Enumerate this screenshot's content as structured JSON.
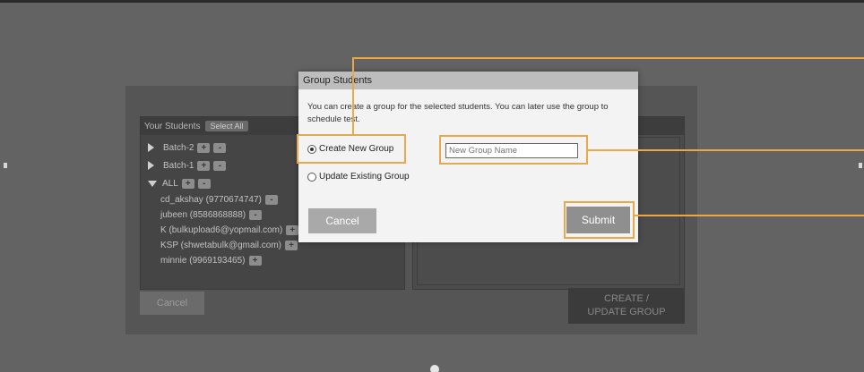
{
  "background": {
    "students_header": "Your Students",
    "select_all_label": "Select All",
    "tree": [
      {
        "label": "Batch-2",
        "expanded": false
      },
      {
        "label": "Batch-1",
        "expanded": false
      },
      {
        "label": "ALL",
        "expanded": true
      }
    ],
    "students": [
      {
        "label": "cd_akshay (9770674747)",
        "action": "-"
      },
      {
        "label": "jubeen (8586868888)",
        "action": "-"
      },
      {
        "label": "K (bulkupload6@yopmail.com)",
        "action": "+"
      },
      {
        "label": "KSP (shwetabulk@gmail.com)",
        "action": "+"
      },
      {
        "label": "minnie (9969193465)",
        "action": "+"
      }
    ],
    "plus_symbol": "+",
    "minus_symbol": "-",
    "cancel_label": "Cancel",
    "create_update_label_line1": "CREATE /",
    "create_update_label_line2": "UPDATE GROUP"
  },
  "modal": {
    "title": "Group Students",
    "description": "You can create a group for the selected students. You can later use the group to schedule test.",
    "option_create": "Create New Group",
    "option_update": "Update Existing Group",
    "selected_option": "create",
    "group_name_placeholder": "New Group Name",
    "group_name_value": "",
    "cancel_label": "Cancel",
    "submit_label": "Submit"
  },
  "colors": {
    "highlight": "#e8a94b",
    "overlay": "#636363",
    "modal_bg": "#f3f3f3"
  }
}
